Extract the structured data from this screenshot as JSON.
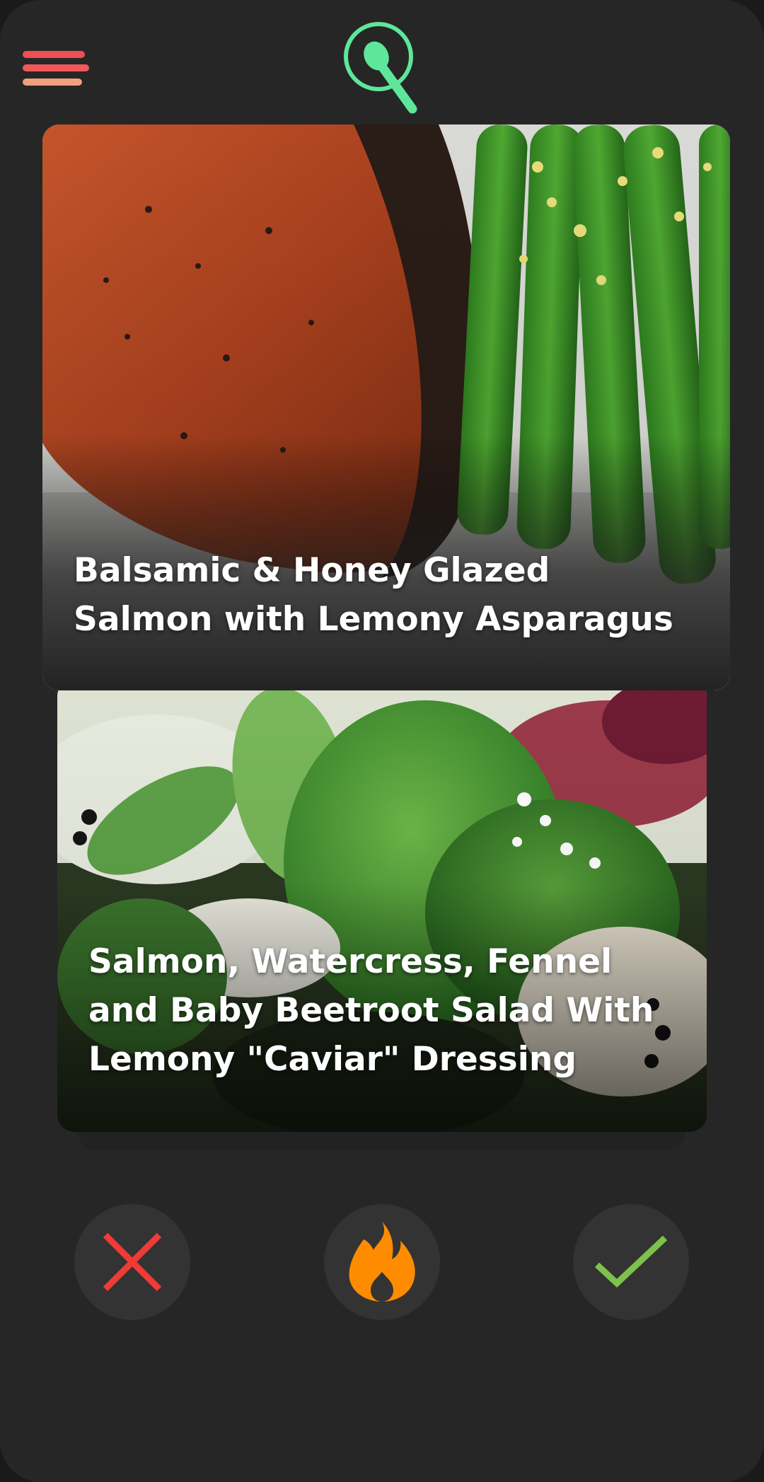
{
  "header": {
    "menu_icon": "hamburger-menu-icon",
    "logo_icon": "spoon-search-logo-icon"
  },
  "cards": [
    {
      "title": "Balsamic & Honey Glazed Salmon with Lemony Asparagus",
      "title_lines": [
        "Balsamic & Honey Glazed",
        "Salmon with Lemony Asparagus"
      ]
    },
    {
      "title": "Salmon, Watercress, Fennel and Baby Beetroot Salad With Lemony \"Caviar\" Dressing",
      "title_lines": [
        "Salmon, Watercress, Fennel",
        "and Baby Beetroot Salad With",
        "Lemony \"Caviar\" Dressing"
      ]
    }
  ],
  "actions": {
    "reject_icon": "close-x-icon",
    "fire_icon": "flame-icon",
    "accept_icon": "checkmark-icon"
  },
  "colors": {
    "background": "#262626",
    "menu_bar_1": "#f04e52",
    "menu_bar_2": "#f2585a",
    "menu_bar_3": "#f0a07c",
    "logo_green": "#5ee69a",
    "reject": "#ef3b36",
    "fire": "#ff8c00",
    "accept": "#7dc24b",
    "button_bg": "#333333"
  }
}
